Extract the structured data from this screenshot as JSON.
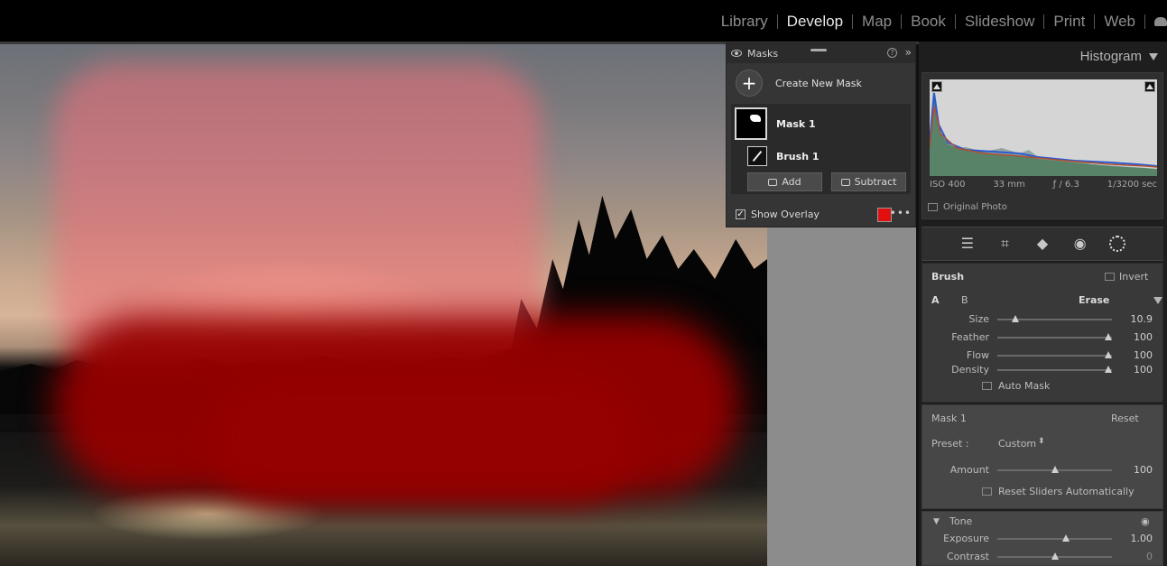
{
  "top_nav": {
    "modules": [
      {
        "label": "Library",
        "active": false
      },
      {
        "label": "Develop",
        "active": true
      },
      {
        "label": "Map",
        "active": false
      },
      {
        "label": "Book",
        "active": false
      },
      {
        "label": "Slideshow",
        "active": false
      },
      {
        "label": "Print",
        "active": false
      },
      {
        "label": "Web",
        "active": false
      }
    ]
  },
  "masks_panel": {
    "title": "Masks",
    "create_label": "Create New Mask",
    "mask_name": "Mask 1",
    "brush_name": "Brush 1",
    "add_label": "Add",
    "subtract_label": "Subtract",
    "overlay_label": "Show Overlay",
    "overlay_checked": true,
    "overlay_color": "#e01010"
  },
  "histogram": {
    "title": "Histogram",
    "iso": "ISO 400",
    "focal": "33 mm",
    "aperture": "ƒ / 6.3",
    "shutter": "1/3200 sec",
    "original_photo_label": "Original Photo"
  },
  "tools": [
    "sliders-icon",
    "crop-icon",
    "eraser-icon",
    "redeye-icon",
    "masking-icon"
  ],
  "brush": {
    "title": "Brush",
    "invert_label": "Invert",
    "tab_a": "A",
    "tab_b": "B",
    "erase_label": "Erase",
    "sliders": [
      {
        "label": "Size",
        "value": "10.9",
        "pos": 0.16
      },
      {
        "label": "Feather",
        "value": "100",
        "pos": 0.97
      },
      {
        "label": "Flow",
        "value": "100",
        "pos": 0.97
      },
      {
        "label": "Density",
        "value": "100",
        "pos": 0.97
      }
    ],
    "auto_mask_label": "Auto Mask"
  },
  "mask_settings": {
    "title": "Mask 1",
    "reset_label": "Reset",
    "preset_label": "Preset :",
    "preset_value": "Custom",
    "amount_label": "Amount",
    "amount_value": "100",
    "amount_pos": 0.5,
    "reset_sliders_label": "Reset Sliders Automatically"
  },
  "tone": {
    "title": "Tone",
    "sliders": [
      {
        "label": "Exposure",
        "value": "1.00",
        "pos": 0.6
      },
      {
        "label": "Contrast",
        "value": "0",
        "pos": 0.5
      }
    ]
  }
}
